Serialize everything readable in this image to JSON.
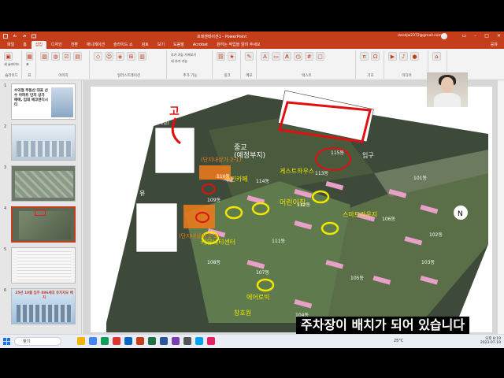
{
  "app": {
    "document_title": "프레젠테이션1 - PowerPoint",
    "account_email": "dandjw2372@gmail.com",
    "account_initial": "",
    "share_label": "공유",
    "tabs": [
      "파일",
      "홈",
      "삽입",
      "디자인",
      "전환",
      "애니메이션",
      "슬라이드 쇼",
      "검토",
      "보기",
      "도움말",
      "Acrobat",
      "원하는 작업을 알려 주세요"
    ],
    "active_tab": "삽입"
  },
  "ribbon": {
    "groups": [
      {
        "label": "슬라이드",
        "buttons": [
          "새 슬라이드"
        ]
      },
      {
        "label": "표",
        "buttons": [
          "표"
        ]
      },
      {
        "label": "이미지",
        "buttons": [
          "그림",
          "온라인 그림",
          "스크린샷",
          "사진 앨범"
        ]
      },
      {
        "label": "일러스트레이션",
        "buttons": [
          "도형",
          "아이콘",
          "3D 모델",
          "SmartArt",
          "차트"
        ]
      },
      {
        "label": "추가 기능",
        "buttons": [
          "추가 기능 가져오기",
          "내 추가 기능"
        ]
      },
      {
        "label": "링크",
        "buttons": [
          "링크",
          "실행"
        ]
      },
      {
        "label": "메모",
        "buttons": [
          "메모"
        ]
      },
      {
        "label": "텍스트",
        "buttons": [
          "텍스트 상자",
          "머리글/바닥글",
          "WordArt",
          "날짜 및 시간",
          "슬라이드 번호",
          "개체"
        ]
      },
      {
        "label": "기호",
        "buttons": [
          "수식",
          "기호"
        ]
      },
      {
        "label": "미디어",
        "buttons": [
          "비디오",
          "오디오",
          "화면 녹화"
        ]
      },
      {
        "label": "Acrobat",
        "buttons": [
          "미디어 삽입"
        ]
      }
    ]
  },
  "slide_panel": {
    "slides": [
      {
        "number": "1",
        "text": "수익형 부동산 대표 선수 아파트 단지 상가 매매, 임대 에코앤디시티"
      },
      {
        "number": "2",
        "text": ""
      },
      {
        "number": "3",
        "text": ""
      },
      {
        "number": "4",
        "text": ""
      },
      {
        "number": "5",
        "text": ""
      },
      {
        "number": "6",
        "text": "25년 10월 입주 886세대 유치자모 배치"
      }
    ],
    "active_slide": "4"
  },
  "map": {
    "labels": {
      "school": "중교\n(예정부지)",
      "commercial_1": "(단지내상가 2-1)",
      "commercial_2": "(단지내상가 2-2)",
      "kindergarten": "유",
      "guest_house": "게스트하우스",
      "residents_cafe": "주민카페",
      "aerobics": "에어로빅",
      "fitness": "커뮤니티센터",
      "daycare": "어린이집",
      "library": "스마트라운지",
      "walkway": "창호원",
      "entrance": "입구",
      "school_note": "(예정)"
    },
    "buildings": [
      "101동",
      "102동",
      "103동",
      "104동",
      "105동",
      "106동",
      "107동",
      "108동",
      "109동",
      "110동",
      "111동",
      "112동",
      "113동",
      "114동",
      "115동"
    ],
    "handwritten_note": "고",
    "compass": "N"
  },
  "status": {
    "slide_info": "슬라이드 4/7",
    "language": "한국어",
    "zoom": "97%"
  },
  "caption": "주차장이 배치가 되어 있습니다",
  "taskbar": {
    "search_placeholder": "찾기",
    "temperature": "25°C",
    "time": "오후 8:19",
    "date": "2023-07-19"
  }
}
